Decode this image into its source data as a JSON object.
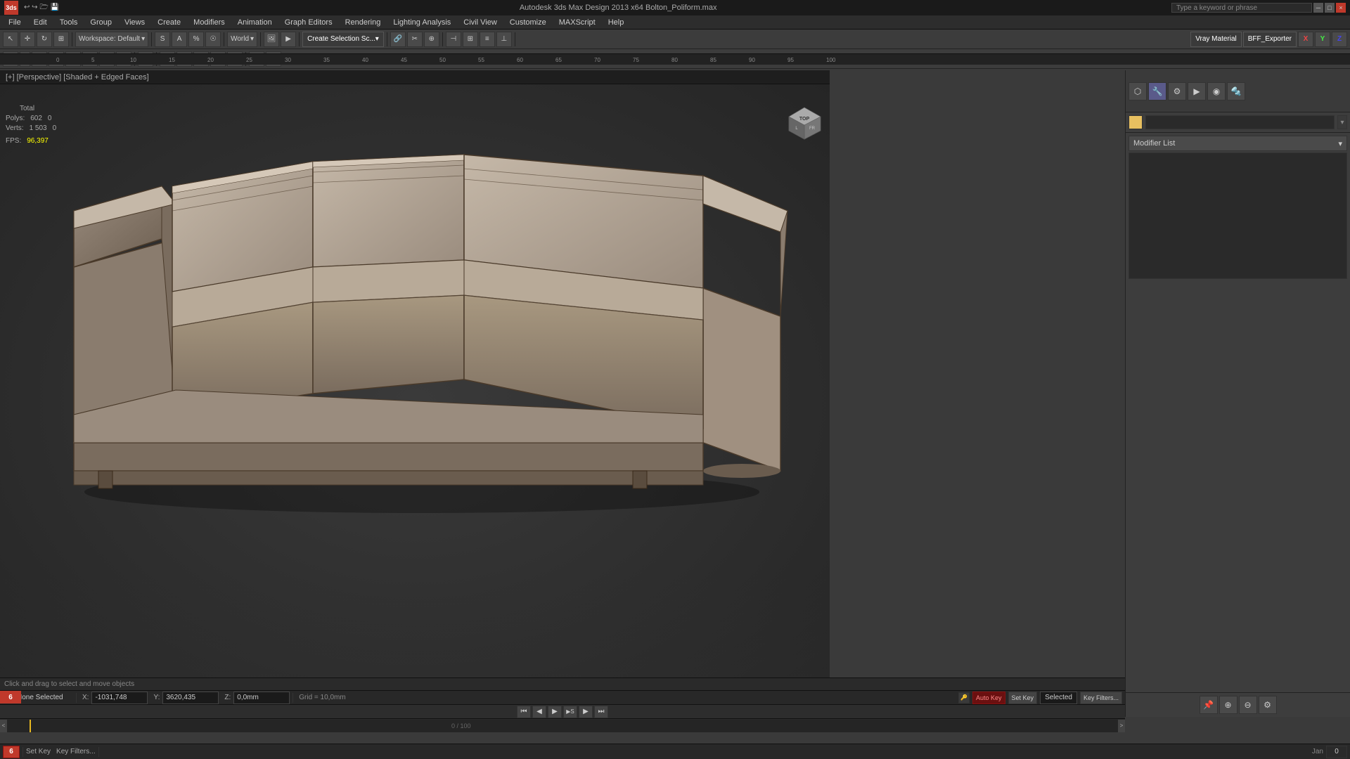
{
  "titleBar": {
    "appName": "3ds",
    "title": "Autodesk 3ds Max Design 2013 x64",
    "filename": "Bolton_Poliform.max",
    "fullTitle": "Autodesk 3ds Max Design 2013 x64    Bolton_Poliform.max",
    "searchPlaceholder": "Type a keyword or phrase",
    "windowControls": {
      "minimize": "─",
      "maximize": "□",
      "close": "×"
    }
  },
  "menuBar": {
    "items": [
      "File",
      "Edit",
      "Tools",
      "Group",
      "Views",
      "Create",
      "Modifiers",
      "Animation",
      "Graph Editors",
      "Rendering",
      "Lighting Analysis",
      "Civil View",
      "Customize",
      "MAXScript",
      "Help"
    ]
  },
  "toolbar1": {
    "workspaceLabel": "Workspace: Default",
    "worldLabel": "World",
    "createSelectionLabel": "Create Selection Sc...",
    "vrayMaterialLabel": "Vray Material",
    "bffExporterLabel": "BFF_Exporter"
  },
  "viewport": {
    "header": "[+] [Perspective] [Shaded + Edged Faces]",
    "stats": {
      "polyLabel": "Polys:",
      "polyTotal": "Total",
      "polyCount": "602",
      "polySelected": "0",
      "vertLabel": "Verts:",
      "vertCount": "1 503",
      "vertSelected": "0",
      "fpsLabel": "FPS:",
      "fpsValue": "96,397"
    }
  },
  "rightPanel": {
    "modifierListLabel": "Modifier List",
    "icons": {
      "create": "⬡",
      "modify": "🔧",
      "hierarchy": "⚙",
      "motion": "▶",
      "display": "◉",
      "utilities": "🔩"
    }
  },
  "statusBar": {
    "selectionStatus": "None Selected",
    "promptText": "Click and drag to select and move objects",
    "xLabel": "X:",
    "xValue": "-1031,748",
    "yLabel": "Y:",
    "yValue": "3620,435",
    "zLabel": "Z:",
    "zValue": "0,0mm",
    "gridLabel": "Grid = 10,0mm",
    "autoKeyLabel": "Auto Key",
    "selectedLabel": "Selected",
    "setKeyLabel": "Set Key",
    "keyFiltersLabel": "Key Filters...",
    "frameNumber": "6",
    "timelineRange": "0 / 100"
  },
  "colors": {
    "background": "#2a2a2a",
    "toolbar": "#3c3c3c",
    "menuBar": "#2d2d2d",
    "titleBar": "#1a1a1a",
    "sofaColor": "#b5a898",
    "sofaEdge": "#4a3a2a",
    "sofaShadow": "#8a7a6a",
    "rightPanel": "#3d3d3d",
    "accent": "#c0392b",
    "fpsColor": "#ffff00",
    "frameRedBox": "#c0392b"
  },
  "coordValues": {
    "x": "-1031,748",
    "y": "3620,435",
    "z": "0,0mm"
  }
}
